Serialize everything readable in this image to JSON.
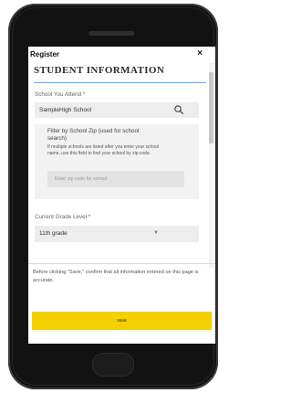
{
  "modal": {
    "title": "Register",
    "close_label": "×"
  },
  "section": {
    "title": "STUDENT INFORMATION"
  },
  "school": {
    "label": "School You Attend *",
    "value": "SampleHigh School",
    "icon": "search-icon"
  },
  "zip_filter": {
    "title": "Filter by School Zip (used for school search)",
    "help": "If multiple schools are listed after you enter your school name, use this field to find your school by zip code.",
    "placeholder": "Enter zip code for school"
  },
  "grade": {
    "label": "Current Grade Level *",
    "value": "11th grade",
    "icon": "chevron-down-icon"
  },
  "notice": "Before clicking \"Save,\" confirm that all information entered on this page is accurate.",
  "save_button": {
    "label": "save"
  },
  "colors": {
    "accent_underline": "#6fa8dc",
    "save_button": "#f5d000",
    "phone_body": "#121212"
  }
}
